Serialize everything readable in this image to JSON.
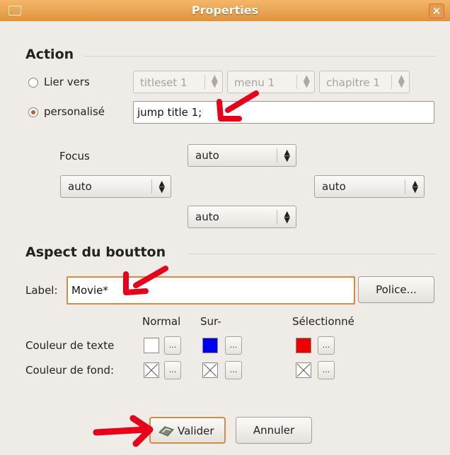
{
  "window": {
    "title": "Properties",
    "close_glyph": "×",
    "icon": "window-menu-icon"
  },
  "action": {
    "heading": "Action",
    "link_to": {
      "label": "Lier vers",
      "checked": false,
      "spinners": [
        {
          "value": "titleset 1"
        },
        {
          "value": "menu 1"
        },
        {
          "value": "chapitre 1"
        }
      ]
    },
    "custom": {
      "label": "personalisé",
      "checked": true,
      "value": "jump title 1;"
    },
    "focus": {
      "label": "Focus",
      "up": "auto",
      "left": "auto",
      "right": "auto",
      "down": "auto"
    }
  },
  "aspect": {
    "heading": "Aspect du boutton",
    "label_caption": "Label:",
    "label_value": "Movie*",
    "font_button": "Police...",
    "columns": {
      "normal": "Normal",
      "over": "Sur-",
      "selected": "Sélectionné"
    },
    "text_color_label": "Couleur de texte",
    "background_color_label": "Couleur de fond:",
    "text_colors": {
      "normal": "#ffffff",
      "over": "#0000ee",
      "selected": "#ee0000"
    },
    "dots_label": "..."
  },
  "footer": {
    "ok_label": "Valider",
    "cancel_label": "Annuler"
  },
  "colors": {
    "accent": "#e1933c",
    "annotation_arrow": "#e8001a"
  }
}
